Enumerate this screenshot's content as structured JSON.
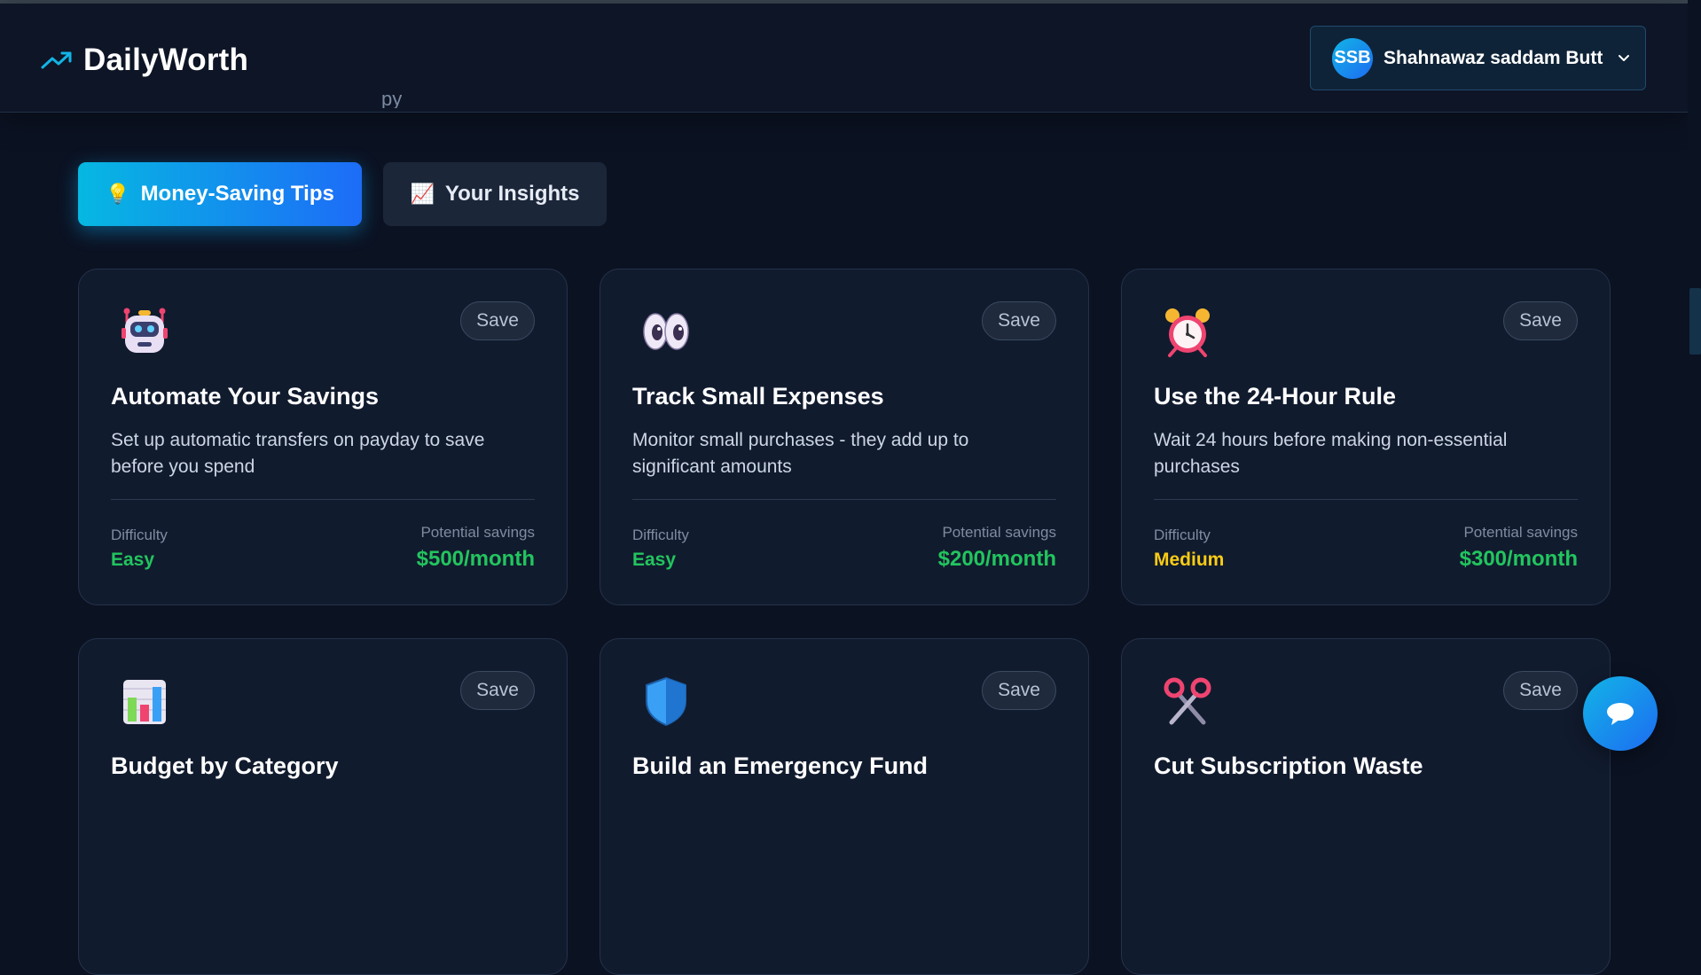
{
  "app": {
    "name": "DailyWorth",
    "brand_icon": "trending-up-icon"
  },
  "header": {
    "partial_text": "py"
  },
  "user": {
    "initials": "SSB",
    "name": "Shahnawaz saddam Butt"
  },
  "tabs": [
    {
      "emoji": "💡",
      "label": "Money-Saving Tips",
      "active": true
    },
    {
      "emoji": "📈",
      "label": "Your Insights",
      "active": false
    }
  ],
  "labels": {
    "save": "Save",
    "difficulty": "Difficulty",
    "potential_savings": "Potential savings"
  },
  "colors": {
    "accent": "#0ea5e9",
    "easy": "#22c55e",
    "medium": "#facc15",
    "savings": "#22c55e"
  },
  "tips": [
    {
      "icon": "robot-icon",
      "title": "Automate Your Savings",
      "description": "Set up automatic transfers on payday to save before you spend",
      "difficulty": "Easy",
      "savings": "$500/month"
    },
    {
      "icon": "eyes-icon",
      "title": "Track Small Expenses",
      "description": "Monitor small purchases - they add up to significant amounts",
      "difficulty": "Easy",
      "savings": "$200/month"
    },
    {
      "icon": "alarm-clock-icon",
      "title": "Use the 24-Hour Rule",
      "description": "Wait 24 hours before making non-essential purchases",
      "difficulty": "Medium",
      "savings": "$300/month"
    },
    {
      "icon": "bar-chart-icon",
      "title": "Budget by Category"
    },
    {
      "icon": "shield-icon",
      "title": "Build an Emergency Fund"
    },
    {
      "icon": "scissors-icon",
      "title": "Cut Subscription Waste"
    }
  ],
  "chat": {
    "icon": "chat-bubble-icon"
  }
}
